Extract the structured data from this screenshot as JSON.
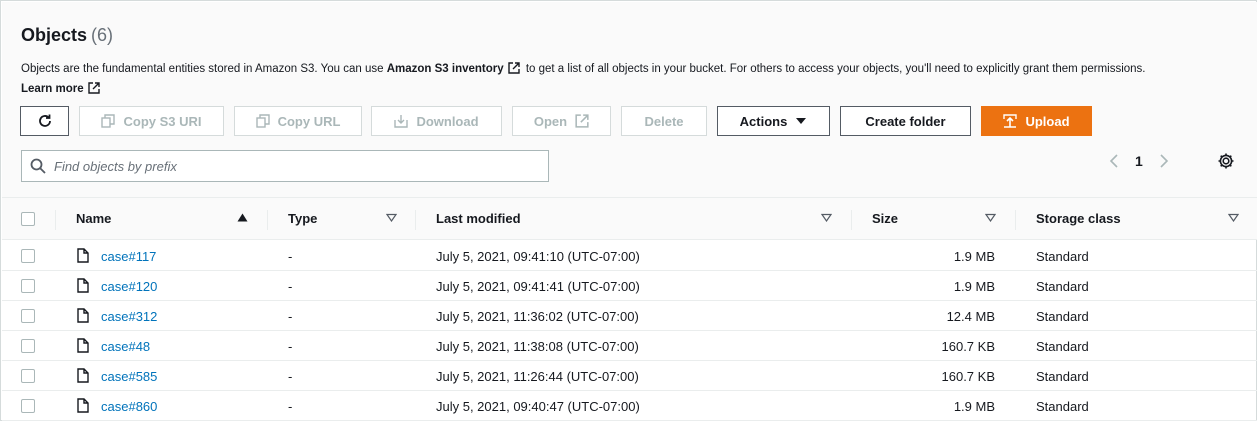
{
  "objects": {
    "title": "Objects",
    "count": "(6)",
    "description_pre": "Objects are the fundamental entities stored in Amazon S3. You can use",
    "description_link": "Amazon S3 inventory",
    "description_post": "to get a list of all objects in your bucket. For others to access your objects, you'll need to explicitly grant them permissions.",
    "learn_more": "Learn more"
  },
  "toolbar": {
    "copy_s3_uri": "Copy S3 URI",
    "copy_url": "Copy URL",
    "download": "Download",
    "open": "Open",
    "delete": "Delete",
    "actions": "Actions",
    "create_folder": "Create folder",
    "upload": "Upload"
  },
  "search": {
    "placeholder": "Find objects by prefix"
  },
  "pagination": {
    "current_page": "1"
  },
  "table": {
    "columns": [
      "Name",
      "Type",
      "Last modified",
      "Size",
      "Storage class"
    ],
    "rows": [
      {
        "name": "case#117",
        "type": "-",
        "modified": "July 5, 2021, 09:41:10 (UTC-07:00)",
        "size": "1.9 MB",
        "storage": "Standard"
      },
      {
        "name": "case#120",
        "type": "-",
        "modified": "July 5, 2021, 09:41:41 (UTC-07:00)",
        "size": "1.9 MB",
        "storage": "Standard"
      },
      {
        "name": "case#312",
        "type": "-",
        "modified": "July 5, 2021, 11:36:02 (UTC-07:00)",
        "size": "12.4 MB",
        "storage": "Standard"
      },
      {
        "name": "case#48",
        "type": "-",
        "modified": "July 5, 2021, 11:38:08 (UTC-07:00)",
        "size": "160.7 KB",
        "storage": "Standard"
      },
      {
        "name": "case#585",
        "type": "-",
        "modified": "July 5, 2021, 11:26:44 (UTC-07:00)",
        "size": "160.7 KB",
        "storage": "Standard"
      },
      {
        "name": "case#860",
        "type": "-",
        "modified": "July 5, 2021, 09:40:47 (UTC-07:00)",
        "size": "1.9 MB",
        "storage": "Standard"
      }
    ]
  },
  "colors": {
    "accent": "#ec7211",
    "link": "#0073bb",
    "text": "#16191f",
    "muted": "#687078",
    "disabled": "#aab7b8"
  },
  "icons": [
    "refresh-icon",
    "copy-icon",
    "download-icon",
    "external-link-icon",
    "caret-down-icon",
    "upload-icon",
    "search-icon",
    "chevron-left-icon",
    "chevron-right-icon",
    "gear-icon",
    "file-icon",
    "sort-asc-icon",
    "sort-desc-icon"
  ]
}
